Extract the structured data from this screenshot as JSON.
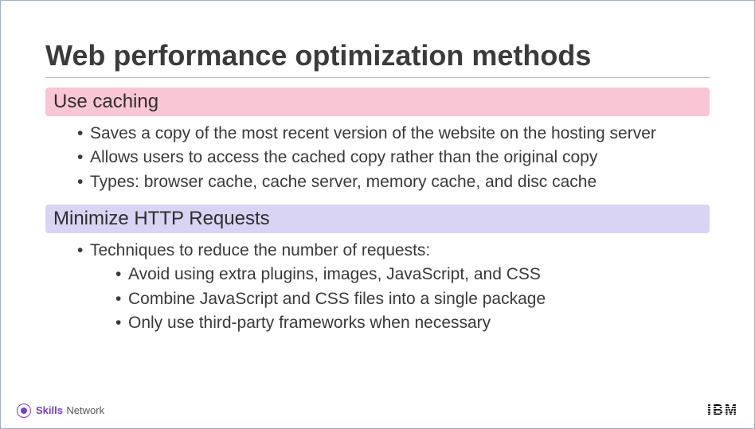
{
  "title": "Web performance optimization methods",
  "sections": [
    {
      "header": "Use caching",
      "color": "pink",
      "bullets": [
        "Saves a copy of the most recent version of the website on the hosting server",
        "Allows users to access the cached copy rather than the original copy",
        "Types: browser cache, cache server, memory cache, and disc cache"
      ]
    },
    {
      "header": "Minimize HTTP Requests",
      "color": "purple",
      "bullets": [
        "Techniques to reduce the number of requests:"
      ],
      "sub_bullets": [
        "Avoid using extra plugins, images, JavaScript, and CSS",
        "Combine JavaScript and CSS files into a single package",
        "Only use third-party frameworks when necessary"
      ]
    }
  ],
  "footer": {
    "skills": "Skills",
    "network": "Network",
    "ibm": "IBM"
  }
}
